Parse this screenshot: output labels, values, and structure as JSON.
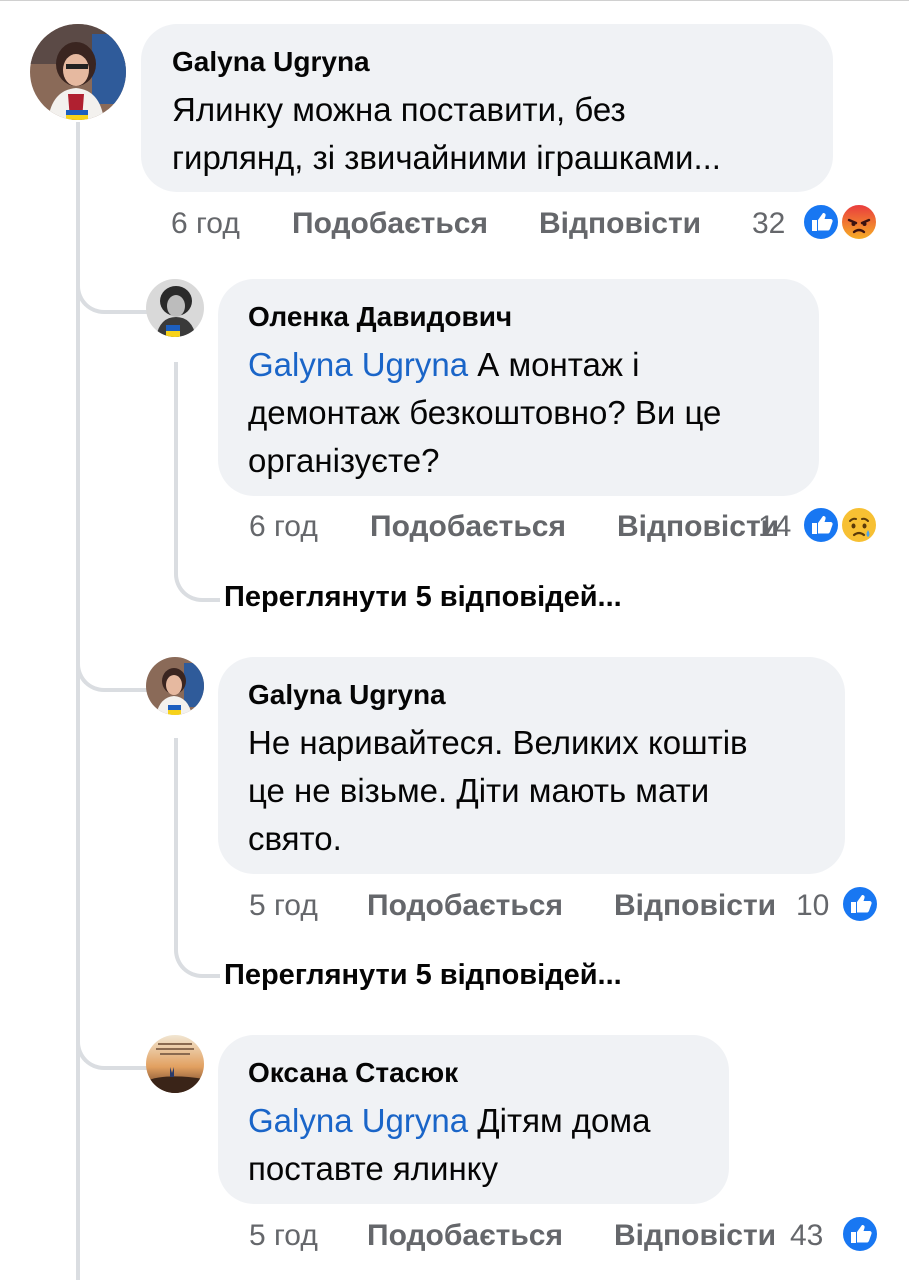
{
  "comments": [
    {
      "author": "Galyna Ugryna",
      "text_line1": "Ялинку можна поставити, без",
      "text_line2": "гирлянд, зі звичайними іграшками...",
      "time": "6 год",
      "like_label": "Подобається",
      "reply_label": "Відповісти",
      "reaction_count": "32",
      "reactions": [
        "like-icon",
        "angry-icon"
      ]
    }
  ],
  "replies": [
    {
      "author": "Оленка Давидович",
      "mention": "Galyna Ugryna",
      "text_line1": "А монтаж і",
      "text_line2": "демонтаж безкоштовно? Ви це",
      "text_line3": "організуєте?",
      "time": "6 год",
      "like_label": "Подобається",
      "reply_label": "Відповісти",
      "reaction_count": "14",
      "reactions": [
        "like-icon",
        "sad-icon"
      ],
      "view_replies": "Переглянути 5 відповідей..."
    },
    {
      "author": "Galyna Ugryna",
      "text_line1": "Не наривайтеся. Великих коштів",
      "text_line2": "це не візьме. Діти мають мати",
      "text_line3": "свято.",
      "time": "5 год",
      "like_label": "Подобається",
      "reply_label": "Відповісти",
      "reaction_count": "10",
      "reactions": [
        "like-icon"
      ],
      "view_replies": "Переглянути 5 відповідей..."
    },
    {
      "author": "Оксана Стасюк",
      "mention": "Galyna Ugryna",
      "text_line1": "Дітям дома",
      "text_line2": "поставте ялинку",
      "time": "5 год",
      "like_label": "Подобається",
      "reply_label": "Відповісти",
      "reaction_count": "43",
      "reactions": [
        "like-icon"
      ]
    }
  ],
  "colors": {
    "bubble": "#f0f2f5",
    "mention": "#1a65c8",
    "like_blue": "#1877f2",
    "meta_gray": "#65676b",
    "thread_line": "#dadde1"
  }
}
